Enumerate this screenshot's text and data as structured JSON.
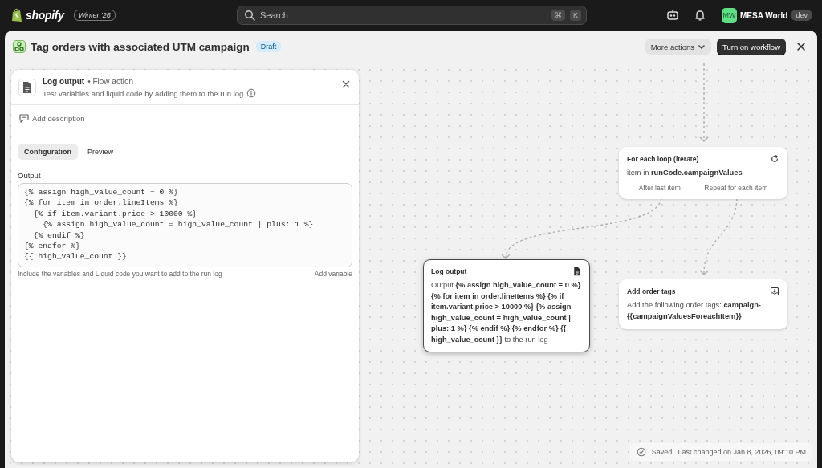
{
  "topbar": {
    "logo": "shopify",
    "edition_badge": "Winter '26",
    "search": {
      "placeholder": "Search",
      "shortcut_keys": [
        "⌘",
        "K"
      ]
    },
    "user": {
      "initials": "MW",
      "name": "MESA World",
      "badge": "dev"
    }
  },
  "header": {
    "title": "Tag orders with associated UTM campaign",
    "status_badge": "Draft",
    "buttons": [
      {
        "label": "More actions",
        "kind": "menu"
      },
      {
        "label": "Turn on workflow",
        "kind": "primary"
      }
    ]
  },
  "panel": {
    "title": "Log output",
    "type_label": "• Flow action",
    "subtitle": "Test variables and liquid code by adding them to the run log",
    "add_description": "Add description",
    "tabs": [
      {
        "label": "Configuration",
        "selected": true
      },
      {
        "label": "Preview",
        "selected": false
      }
    ],
    "output": {
      "label": "Output",
      "value": "{% assign high_value_count = 0 %}\n{% for item in order.lineItems %}\n  {% if item.variant.price > 10000 %}\n    {% assign high_value_count = high_value_count | plus: 1 %}\n  {% endif %}\n{% endfor %}\n{{ high_value_count }}",
      "help": "Include the variables and Liquid code you want to add to the run log",
      "add_variable": "Add variable"
    }
  },
  "canvas": {
    "nodes": [
      {
        "kind": "loop",
        "title": "For each loop (iterate)",
        "body": "item in **runCode.campaignValues**",
        "branches": [
          "After last item",
          "Repeat for each item"
        ],
        "selected": false
      },
      {
        "kind": "log",
        "title": "Log output",
        "body": "Output **{% assign high_value_count = 0 %} {% for item in order.lineItems %} {% if item.variant.price > 10000 %} {% assign high_value_count = high_value_count | plus: 1 %} {% endif %} {% endfor %} {{ high_value_count }}** to the run log",
        "selected": true
      },
      {
        "kind": "tags",
        "title": "Add order tags",
        "body": "Add the following order tags: **campaign-{{campaignValuesForeachItem}}**",
        "selected": false
      }
    ],
    "status": {
      "label": "Saved",
      "detail": "Last changed on Jan 8, 2026, 09:10 PM"
    }
  }
}
